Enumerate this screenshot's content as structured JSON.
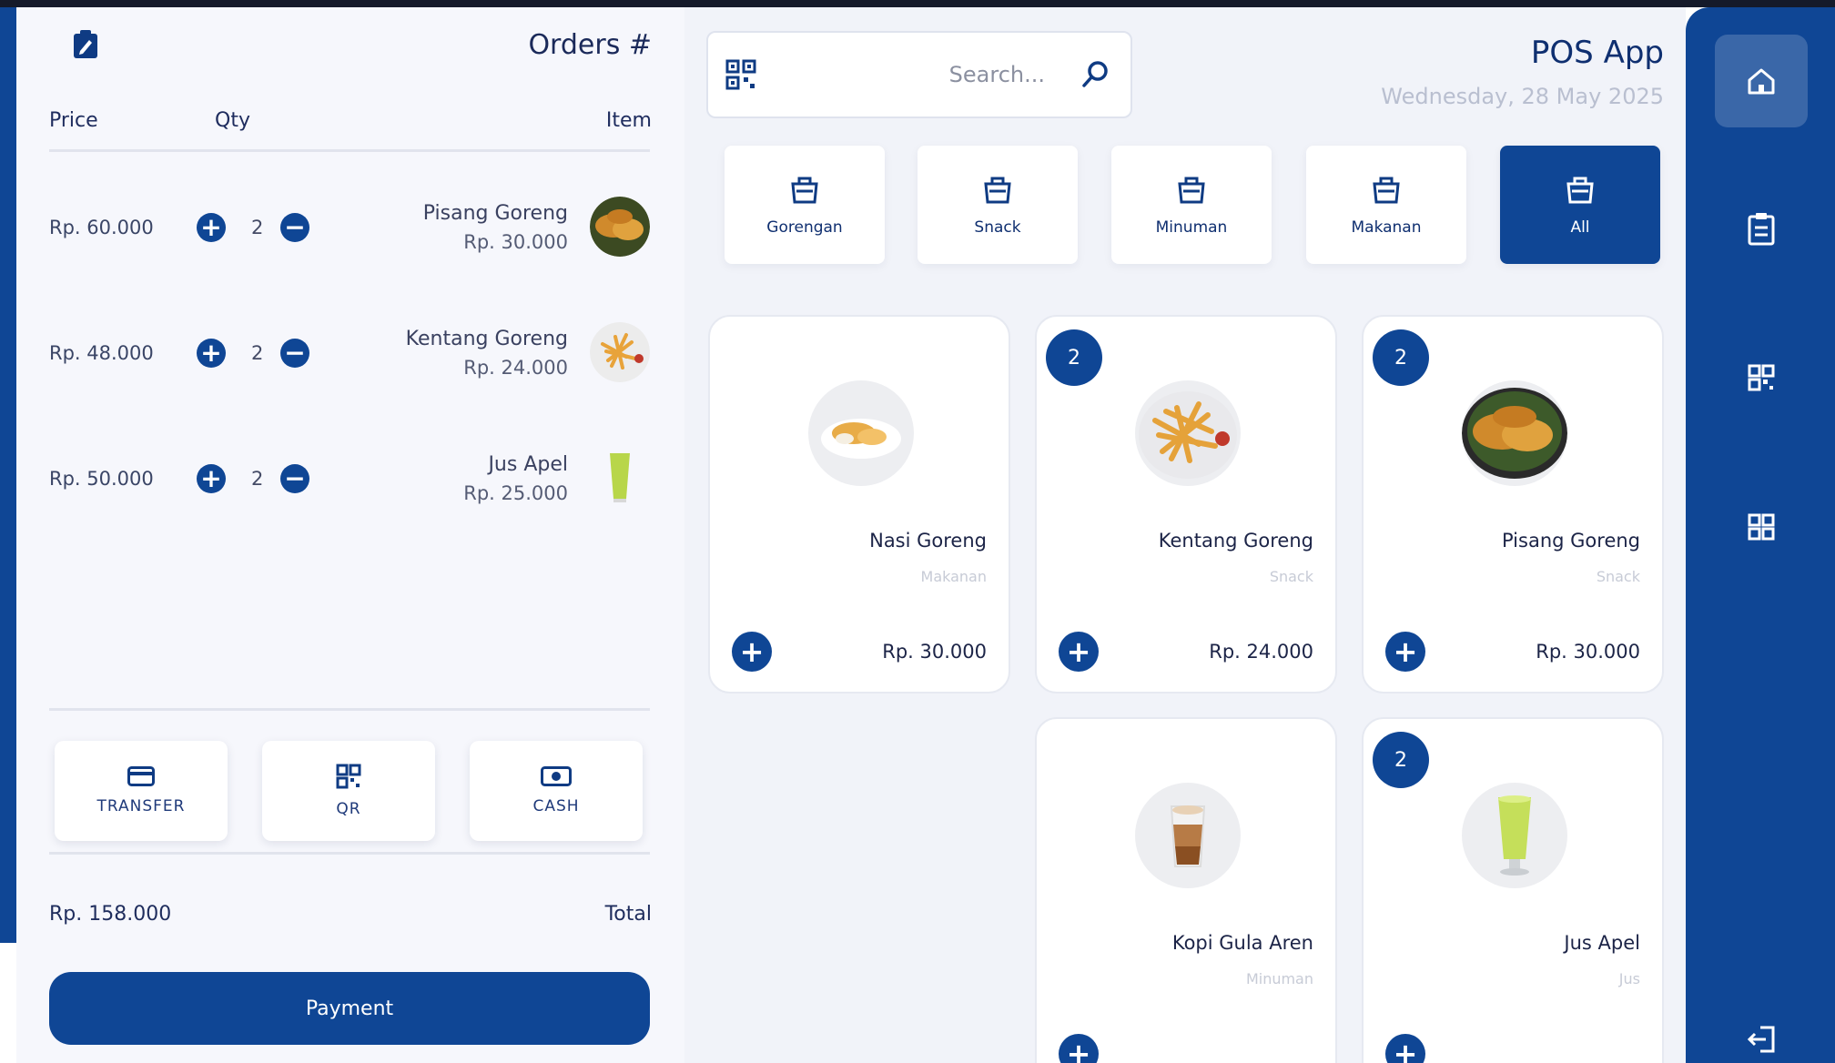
{
  "app": {
    "title": "POS App",
    "date": "Wednesday, 28 May 2025"
  },
  "search": {
    "placeholder": "Search..."
  },
  "categories": [
    {
      "label": "All",
      "active": true
    },
    {
      "label": "Makanan"
    },
    {
      "label": "Minuman"
    },
    {
      "label": "Snack"
    },
    {
      "label": "Gorengan"
    }
  ],
  "products": [
    {
      "name": "Pisang Goreng",
      "category": "Snack",
      "price": "Rp. 30.000",
      "badge": "2"
    },
    {
      "name": "Kentang Goreng",
      "category": "Snack",
      "price": "Rp. 24.000",
      "badge": "2"
    },
    {
      "name": "Nasi Goreng",
      "category": "Makanan",
      "price": "Rp. 30.000"
    },
    {
      "name": "Jus Apel",
      "category": "Jus",
      "badge": "2"
    },
    {
      "name": "Kopi Gula Aren",
      "category": "Minuman"
    }
  ],
  "orders": {
    "title": "Orders #",
    "col_item": "Item",
    "col_qty": "Qty",
    "col_price": "Price",
    "items": [
      {
        "name": "Pisang Goreng",
        "unit_price": "Rp. 30.000",
        "qty": "2",
        "line_total": "Rp. 60.000"
      },
      {
        "name": "Kentang Goreng",
        "unit_price": "Rp. 24.000",
        "qty": "2",
        "line_total": "Rp. 48.000"
      },
      {
        "name": "Jus Apel",
        "unit_price": "Rp. 25.000",
        "qty": "2",
        "line_total": "Rp. 50.000"
      }
    ],
    "payment_methods": [
      "CASH",
      "QR",
      "TRANSFER"
    ],
    "total_label": "Total",
    "total_value": "Rp. 158.000",
    "payment_button": "Payment"
  },
  "sidebar": {
    "items": [
      {
        "icon": "home-icon",
        "active": true
      },
      {
        "icon": "clipboard-icon"
      },
      {
        "icon": "qr-icon"
      },
      {
        "icon": "grid-icon"
      },
      {
        "icon": "logout-icon"
      }
    ]
  },
  "colors": {
    "primary": "#0f4695",
    "panel": "#f6f7fc",
    "main_bg": "#f1f3f9"
  }
}
